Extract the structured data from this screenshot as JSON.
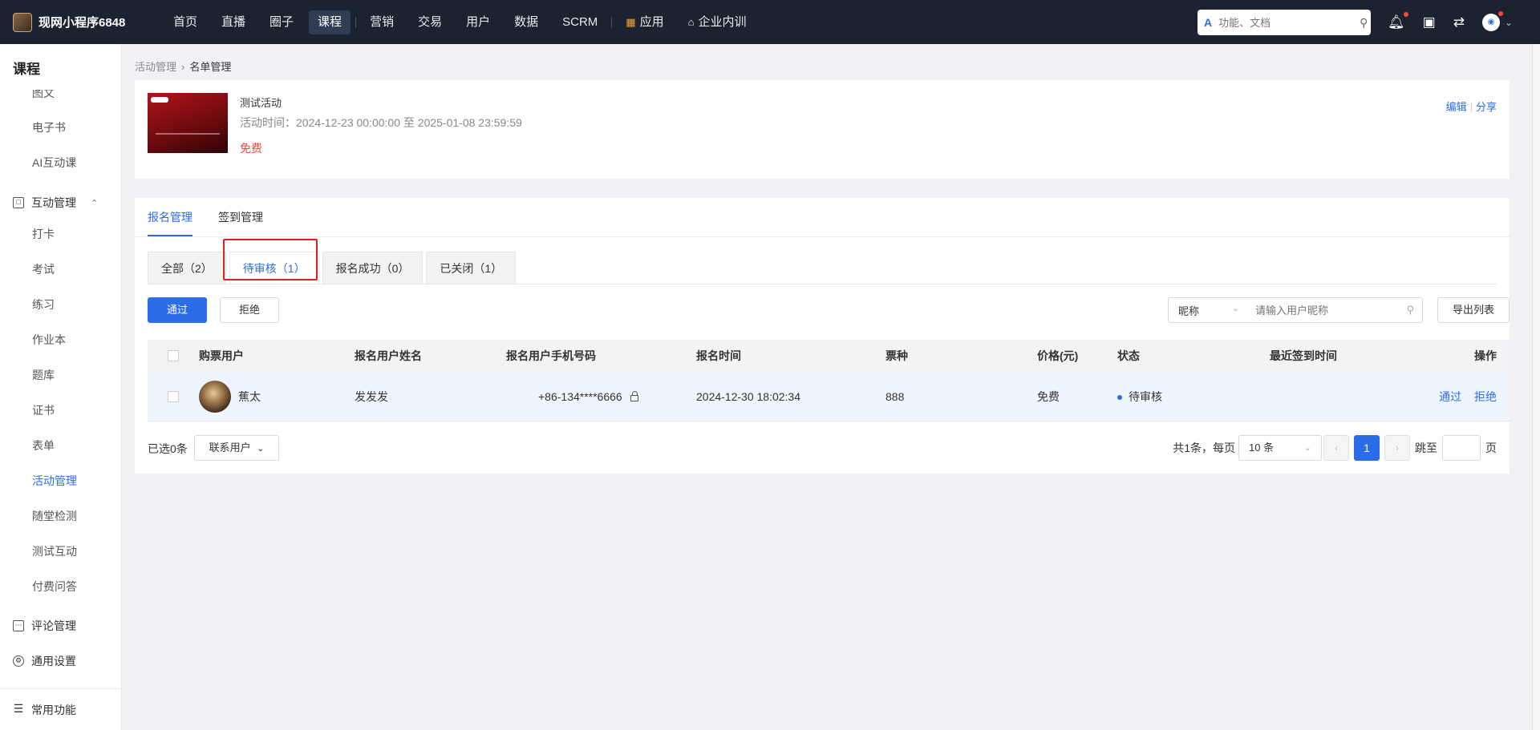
{
  "brand": {
    "name": "现网小程序6848"
  },
  "nav": {
    "items": [
      "首页",
      "直播",
      "圈子",
      "课程",
      "营销",
      "交易",
      "用户",
      "数据",
      "SCRM",
      "应用",
      "企业内训"
    ],
    "active": "课程"
  },
  "search": {
    "placeholder": "功能、文档"
  },
  "sidebar": {
    "title": "课程",
    "items_top": [
      "图文",
      "电子书",
      "AI互动课"
    ],
    "group_interaction": "互动管理",
    "items_interaction": [
      "打卡",
      "考试",
      "练习",
      "作业本",
      "题库",
      "证书",
      "表单",
      "活动管理",
      "随堂检测",
      "测试互动",
      "付费问答"
    ],
    "active": "活动管理",
    "group_comment": "评论管理",
    "group_settings": "通用设置",
    "group_common": "常用功能"
  },
  "breadcrumb": {
    "parent": "活动管理",
    "current": "名单管理"
  },
  "activity": {
    "name": "测试活动",
    "time": "活动时间：2024-12-23 00:00:00 至 2025-01-08 23:59:59",
    "price": "免费",
    "edit": "编辑",
    "share": "分享"
  },
  "tabs": {
    "signup": "报名管理",
    "checkin": "签到管理"
  },
  "subtabs": [
    "全部（2）",
    "待审核（1）",
    "报名成功（0）",
    "已关闭（1）"
  ],
  "buttons": {
    "approve": "通过",
    "reject": "拒绝",
    "export": "导出列表"
  },
  "filter": {
    "field": "昵称",
    "placeholder": "请输入用户昵称"
  },
  "table": {
    "headers": [
      "购票用户",
      "报名用户姓名",
      "报名用户手机号码",
      "报名时间",
      "票种",
      "价格(元)",
      "状态",
      "最近签到时间",
      "操作"
    ],
    "rows": [
      {
        "buyer": "蕉太",
        "name": "发发发",
        "phone": "+86-134****6666",
        "time": "2024-12-30 18:02:34",
        "ticket": "888",
        "price": "免费",
        "status": "待审核",
        "last_checkin": "",
        "op_approve": "通过",
        "op_reject": "拒绝"
      }
    ]
  },
  "footer": {
    "selected": "已选0条",
    "contact": "联系用户",
    "total": "共1条，每页",
    "page_size": "10 条",
    "current_page": "1",
    "jump_label": "跳至",
    "page_unit": "页"
  },
  "colors": {
    "accent": "#2b6de8",
    "topbar": "#1c2330",
    "danger": "#f04b3c",
    "highlight": "#e02020"
  }
}
